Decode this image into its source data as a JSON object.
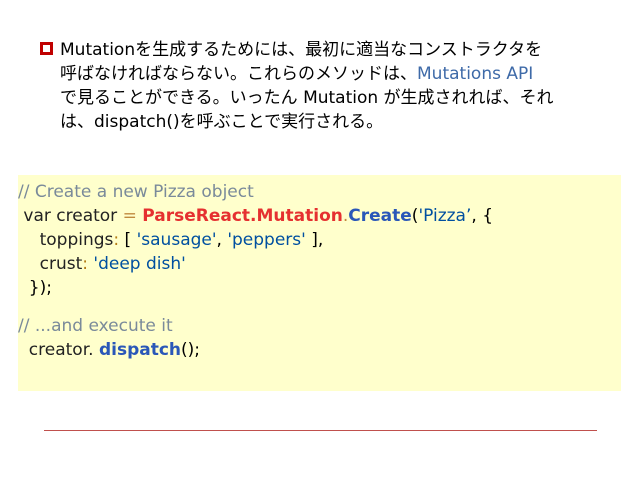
{
  "bullet": {
    "line1": "Mutationを生成するためには、最初に適当なコンストラクタを",
    "line2_pre": "呼ばなければならない。これらのメソッドは、",
    "line2_link": "Mutations API",
    "line3": "で見ることができる。いったん Mutation が生成されれば、それ",
    "line4": "は、dispatch()を呼ぶことで実行される。"
  },
  "code": {
    "comment1": "// Create a new Pizza object",
    "l2_var": " var creator ",
    "l2_eq": "=",
    "l2_sp": " ",
    "l2_parse": "ParseReact.Mutation",
    "l2_dot": ".",
    "l2_create": "Create",
    "l2_open": "(",
    "l2_str": "'Pizza’",
    "l2_rest": ", {",
    "l3_key": "    toppings",
    "l3_colon": ":",
    "l3_open": " [ ",
    "l3_s1": "'sausage'",
    "l3_comma": ", ",
    "l3_s2": "'peppers'",
    "l3_close": " ],",
    "l4_key": "    crust",
    "l4_colon": ":",
    "l4_sp": " ",
    "l4_s": "'deep dish'",
    "l5": "  });",
    "comment2": "// ...and execute it",
    "l7_obj": "  creator. ",
    "l7_fn": "dispatch",
    "l7_rest": "();"
  }
}
